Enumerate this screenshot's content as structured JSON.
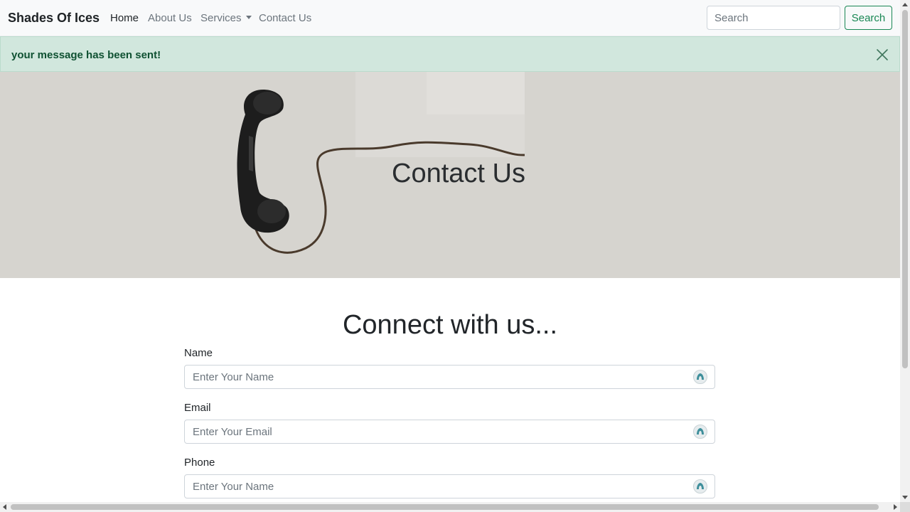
{
  "navbar": {
    "brand": "Shades Of Ices",
    "links": [
      {
        "label": "Home"
      },
      {
        "label": "About Us"
      },
      {
        "label": "Services"
      },
      {
        "label": "Contact Us"
      }
    ],
    "search": {
      "placeholder": "Search",
      "button_label": "Search"
    }
  },
  "alert": {
    "message": "your message has been sent!",
    "close_icon": "close-icon"
  },
  "hero": {
    "title": "Contact Us",
    "image": "telephone-handset-photo"
  },
  "main": {
    "heading": "Connect with us...",
    "fields": [
      {
        "label": "Name",
        "placeholder": "Enter Your Name",
        "value": ""
      },
      {
        "label": "Email",
        "placeholder": "Enter Your Email",
        "value": ""
      },
      {
        "label": "Phone",
        "placeholder": "Enter Your Name",
        "value": ""
      }
    ]
  },
  "colors": {
    "accent": "#198754",
    "alert_bg": "#d1e7dd",
    "alert_text": "#0f5132",
    "navbar_bg": "#f8f9fa",
    "hero_bg": "#d6d4cf"
  }
}
